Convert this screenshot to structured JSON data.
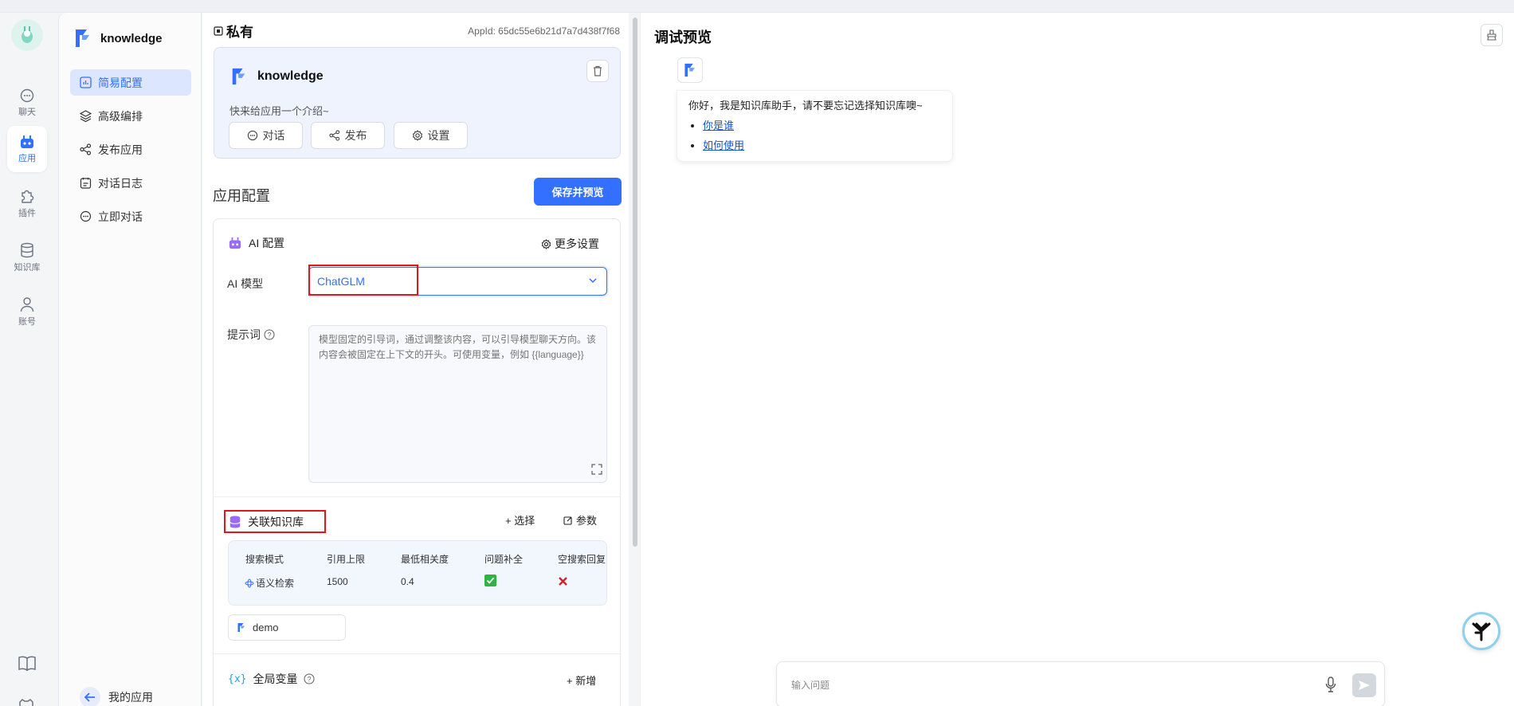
{
  "rail": {
    "items": [
      {
        "label": "聊天",
        "icon": "chat-icon"
      },
      {
        "label": "应用",
        "icon": "robot-icon",
        "active": true
      },
      {
        "label": "插件",
        "icon": "puzzle-icon"
      },
      {
        "label": "知识库",
        "icon": "database-icon"
      },
      {
        "label": "账号",
        "icon": "user-icon"
      }
    ]
  },
  "sidebar": {
    "app_name": "knowledge",
    "items": [
      {
        "label": "简易配置",
        "icon": "chart-icon",
        "active": true
      },
      {
        "label": "高级编排",
        "icon": "layers-icon"
      },
      {
        "label": "发布应用",
        "icon": "share-icon"
      },
      {
        "label": "对话日志",
        "icon": "log-icon"
      },
      {
        "label": "立即对话",
        "icon": "chat-icon"
      }
    ],
    "back_label": "我的应用"
  },
  "config": {
    "visibility": "私有",
    "app_id": "AppId: 65dc55e6b21d7a7d438f7f68",
    "card": {
      "name": "knowledge",
      "intro": "快来给应用一个介绍~",
      "buttons": [
        "对话",
        "发布",
        "设置"
      ]
    },
    "section_title": "应用配置",
    "save_label": "保存并预览",
    "ai": {
      "header": "AI 配置",
      "more_settings": "更多设置",
      "model_label": "AI 模型",
      "model_value": "ChatGLM",
      "prompt_label": "提示词",
      "prompt_placeholder": "模型固定的引导词，通过调整该内容，可以引导模型聊天方向。该内容会被固定在上下文的开头。可使用变量，例如 {{language}}"
    },
    "kb": {
      "header": "关联知识库",
      "select_label": "+ 选择",
      "params_label": "参数",
      "columns": [
        "搜索模式",
        "引用上限",
        "最低相关度",
        "问题补全",
        "空搜索回复"
      ],
      "row": {
        "mode": "语义检索",
        "limit": "1500",
        "min_score": "0.4",
        "completion": true,
        "empty_reply": false
      },
      "dataset": "demo"
    },
    "vars": {
      "header": "全局变量",
      "add_label": "+ 新增"
    }
  },
  "preview": {
    "title": "调试预览",
    "welcome": "你好，我是知识库助手，请不要忘记选择知识库噢~",
    "links": [
      "你是谁",
      "如何使用"
    ],
    "input_placeholder": "输入问题"
  },
  "colors": {
    "accent": "#3370ff",
    "highlight": "#e0161b"
  }
}
